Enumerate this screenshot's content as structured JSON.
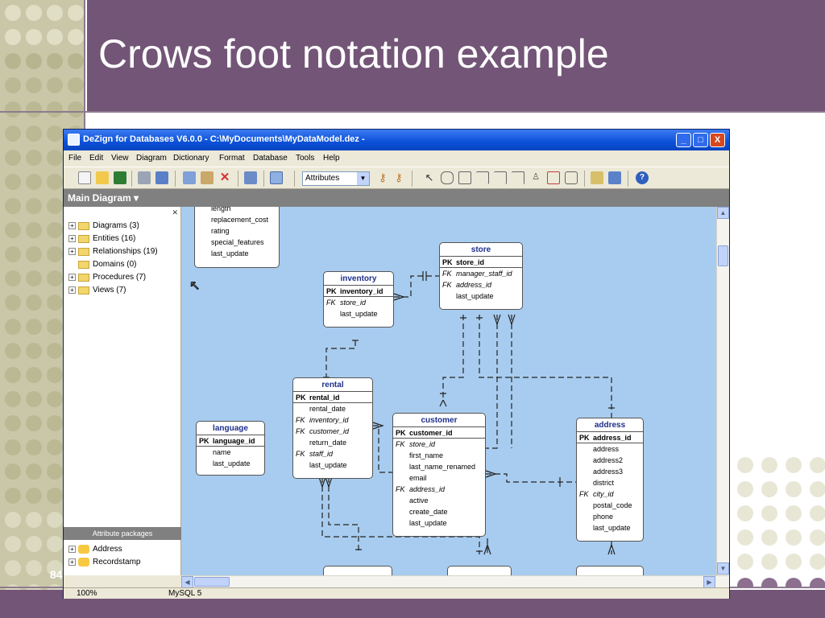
{
  "slide": {
    "title": "Crows foot notation example",
    "page_number": "84"
  },
  "window": {
    "title": "DeZign for Databases V6.0.0 - C:\\MyDocuments\\MyDataModel.dez -",
    "min_label": "_",
    "max_label": "□",
    "close_label": "X"
  },
  "menu": [
    "File",
    "Edit",
    "View",
    "Diagram",
    "Dictionary",
    "Format",
    "Database",
    "Tools",
    "Help"
  ],
  "toolbar": {
    "select_value": "Attributes",
    "icons": [
      "new-icon",
      "open-icon",
      "save-icon",
      "print-icon",
      "preview-icon",
      "copy-icon",
      "paste-icon",
      "delete-icon",
      "swap-icon",
      "zoom-icon",
      "pointer-icon",
      "entity-icon",
      "relationship-icon",
      "help-icon"
    ]
  },
  "diagram": {
    "header": "Main Diagram",
    "header_arrow": "▾"
  },
  "tree": {
    "items": [
      {
        "label": "Diagrams (3)",
        "expand": "+"
      },
      {
        "label": "Entities (16)",
        "expand": "+"
      },
      {
        "label": "Relationships (19)",
        "expand": "+"
      },
      {
        "label": "Domains (0)",
        "expand": ""
      },
      {
        "label": "Procedures (7)",
        "expand": "+"
      },
      {
        "label": "Views (7)",
        "expand": "+"
      }
    ],
    "packages_header": "Attribute packages",
    "packages": [
      {
        "label": "Address",
        "expand": "+"
      },
      {
        "label": "Recordstamp",
        "expand": "+"
      }
    ]
  },
  "entities": {
    "film_stub": {
      "rows": [
        "length",
        "replacement_cost",
        "rating",
        "special_features",
        "last_update"
      ]
    },
    "inventory": {
      "name": "inventory",
      "pk": "inventory_id",
      "fks": [
        "store_id"
      ],
      "attrs": [
        "last_update"
      ]
    },
    "store": {
      "name": "store",
      "pk": "store_id",
      "fks": [
        "manager_staff_id",
        "address_id"
      ],
      "attrs": [
        "last_update"
      ]
    },
    "rental": {
      "name": "rental",
      "pk": "rental_id",
      "rows": [
        {
          "pre": "",
          "text": "rental_date",
          "fk": false
        },
        {
          "pre": "FK",
          "text": "inventory_id",
          "fk": true
        },
        {
          "pre": "FK",
          "text": "customer_id",
          "fk": true
        },
        {
          "pre": "",
          "text": "return_date",
          "fk": false
        },
        {
          "pre": "FK",
          "text": "staff_id",
          "fk": true
        },
        {
          "pre": "",
          "text": "last_update",
          "fk": false
        }
      ]
    },
    "language": {
      "name": "language",
      "pk": "language_id",
      "attrs": [
        "name",
        "last_update"
      ]
    },
    "customer": {
      "name": "customer",
      "pk": "customer_id",
      "rows": [
        {
          "pre": "FK",
          "text": "store_id",
          "fk": true
        },
        {
          "pre": "",
          "text": "first_name",
          "fk": false
        },
        {
          "pre": "",
          "text": "last_name_renamed",
          "fk": false
        },
        {
          "pre": "",
          "text": "email",
          "fk": false
        },
        {
          "pre": "FK",
          "text": "address_id",
          "fk": true
        },
        {
          "pre": "",
          "text": "active",
          "fk": false
        },
        {
          "pre": "",
          "text": "create_date",
          "fk": false
        },
        {
          "pre": "",
          "text": "last_update",
          "fk": false
        }
      ]
    },
    "address": {
      "name": "address",
      "pk": "address_id",
      "rows": [
        {
          "pre": "",
          "text": "address",
          "fk": false
        },
        {
          "pre": "",
          "text": "address2",
          "fk": false
        },
        {
          "pre": "",
          "text": "address3",
          "fk": false
        },
        {
          "pre": "",
          "text": "district",
          "fk": false
        },
        {
          "pre": "FK",
          "text": "city_id",
          "fk": true
        },
        {
          "pre": "",
          "text": "postal_code",
          "fk": false
        },
        {
          "pre": "",
          "text": "phone",
          "fk": false
        },
        {
          "pre": "",
          "text": "last_update",
          "fk": false
        }
      ]
    },
    "pk_prefix": "PK",
    "fk_prefix": "FK"
  },
  "status": {
    "zoom": "100%",
    "database": "MySQL 5"
  },
  "colors": {
    "slide_purple": "#735577",
    "dot_light": "#e0dfc6",
    "canvas": "#a8ccef",
    "entity_title": "#1e2f8c"
  }
}
